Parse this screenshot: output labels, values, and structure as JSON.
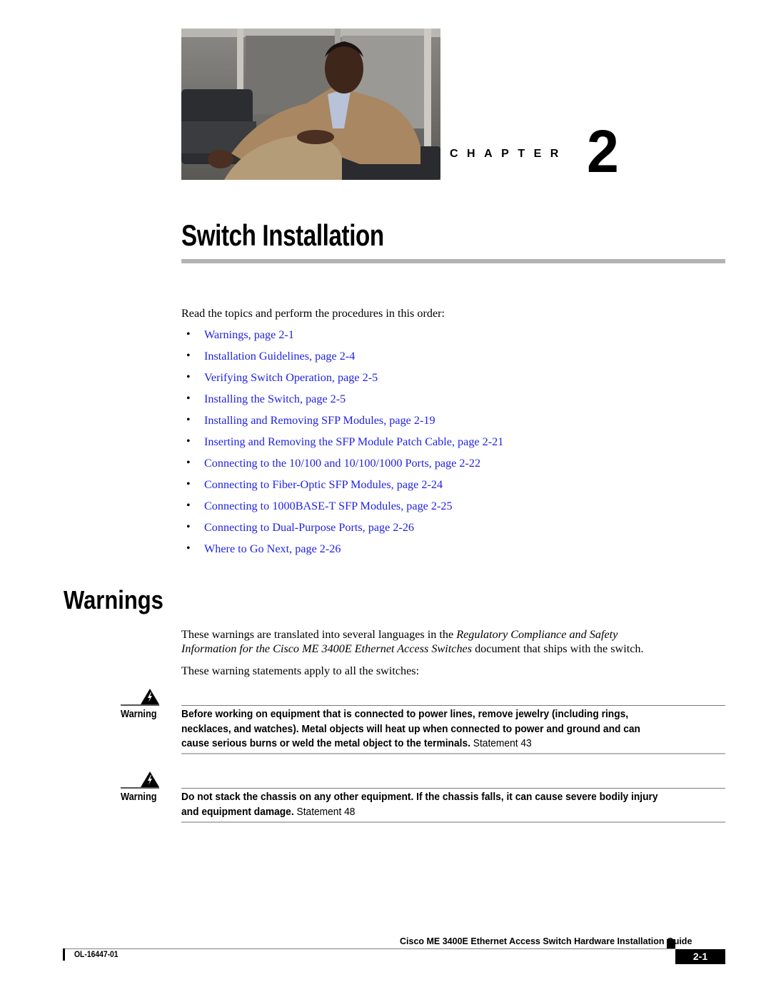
{
  "document": {
    "chapter_label": "CHAPTER",
    "chapter_number": "2",
    "title": "Switch Installation",
    "photo_icon": "chapter-photo"
  },
  "intro": {
    "text": "Read the topics and perform the procedures in this order:"
  },
  "toc": {
    "bullet_icon": "bullet-icon",
    "items": [
      {
        "label": "Warnings, page 2-1"
      },
      {
        "label": "Installation Guidelines, page 2-4"
      },
      {
        "label": "Verifying Switch Operation, page 2-5"
      },
      {
        "label": "Installing the Switch, page 2-5"
      },
      {
        "label": "Installing and Removing SFP Modules, page 2-19"
      },
      {
        "label": "Inserting and Removing the SFP Module Patch Cable, page 2-21"
      },
      {
        "label": "Connecting to the 10/100 and 10/100/1000 Ports, page 2-22"
      },
      {
        "label": "Connecting to Fiber-Optic SFP Modules, page 2-24"
      },
      {
        "label": "Connecting to 1000BASE-T SFP Modules, page 2-25"
      },
      {
        "label": "Connecting to Dual-Purpose Ports, page 2-26"
      },
      {
        "label": "Where to Go Next, page 2-26"
      }
    ],
    "link_color": "#2222e6"
  },
  "warnings_section": {
    "heading": "Warnings",
    "para1": {
      "pre": "These warnings are translated into several languages in the ",
      "italic1": "Regulatory Compliance and Safety",
      "italic2": "Information for the Cisco ME 3400E Ethernet Access Switches",
      "post": " document that ships with the switch."
    },
    "para2": "These warning statements apply to all the switches:",
    "warnings": [
      {
        "label": "Warning",
        "icon": "warning-triangle-icon",
        "lines": [
          "Before working on equipment that is connected to power lines, remove jewelry (including rings,",
          "necklaces, and watches). Metal objects will heat up when connected to power and ground and can",
          "cause serious burns or weld the metal object to the terminals."
        ],
        "statement": " Statement 43"
      },
      {
        "label": "Warning",
        "icon": "warning-triangle-icon",
        "lines": [
          "Do not stack the chassis on any other equipment. If the chassis falls, it can cause severe bodily injury",
          "and equipment damage."
        ],
        "statement": " Statement 48"
      }
    ]
  },
  "footer": {
    "guide_title": "Cisco ME 3400E Ethernet Access Switch Hardware Installation Guide",
    "doc_number": "OL-16447-01",
    "page_number": "2-1"
  }
}
